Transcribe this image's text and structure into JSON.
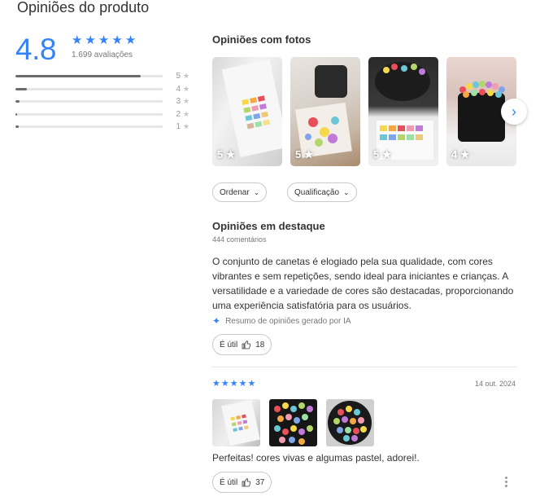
{
  "page_title": "Opiniões do produto",
  "rating": {
    "score": "4.8",
    "stars": 5,
    "count_label": "1.699 avaliações",
    "distribution": [
      {
        "label": "5",
        "fraction": 0.85
      },
      {
        "label": "4",
        "fraction": 0.08
      },
      {
        "label": "3",
        "fraction": 0.03
      },
      {
        "label": "2",
        "fraction": 0.01
      },
      {
        "label": "1",
        "fraction": 0.02
      }
    ]
  },
  "photos_section": {
    "title": "Opiniões com fotos",
    "photos": [
      {
        "score": "5"
      },
      {
        "score": "5"
      },
      {
        "score": "5"
      },
      {
        "score": "4"
      }
    ]
  },
  "filters": {
    "order_label": "Ordenar",
    "rating_label": "Qualificação"
  },
  "featured": {
    "title": "Opiniões em destaque",
    "comments_count": "444 comentários",
    "summary": "O conjunto de canetas é elogiado pela sua qualidade, com cores vibrantes e sem repetições, sendo ideal para iniciantes e crianças. A versatilidade e a variedade de cores são destacadas, proporcionando uma experiência satisfatória para os usuários.",
    "ai_note": "Resumo de opiniões gerado por IA",
    "useful_label": "É útil",
    "useful_count": "18"
  },
  "review": {
    "stars": 5,
    "date": "14 out. 2024",
    "text": "Perfeitas! cores vivas e algumas pastel, adorei!.",
    "useful_label": "É útil",
    "useful_count": "37"
  },
  "colors": {
    "accent": "#3483fa",
    "bar_fill": "#6b6b6b",
    "bar_track": "#e6e6e6"
  }
}
